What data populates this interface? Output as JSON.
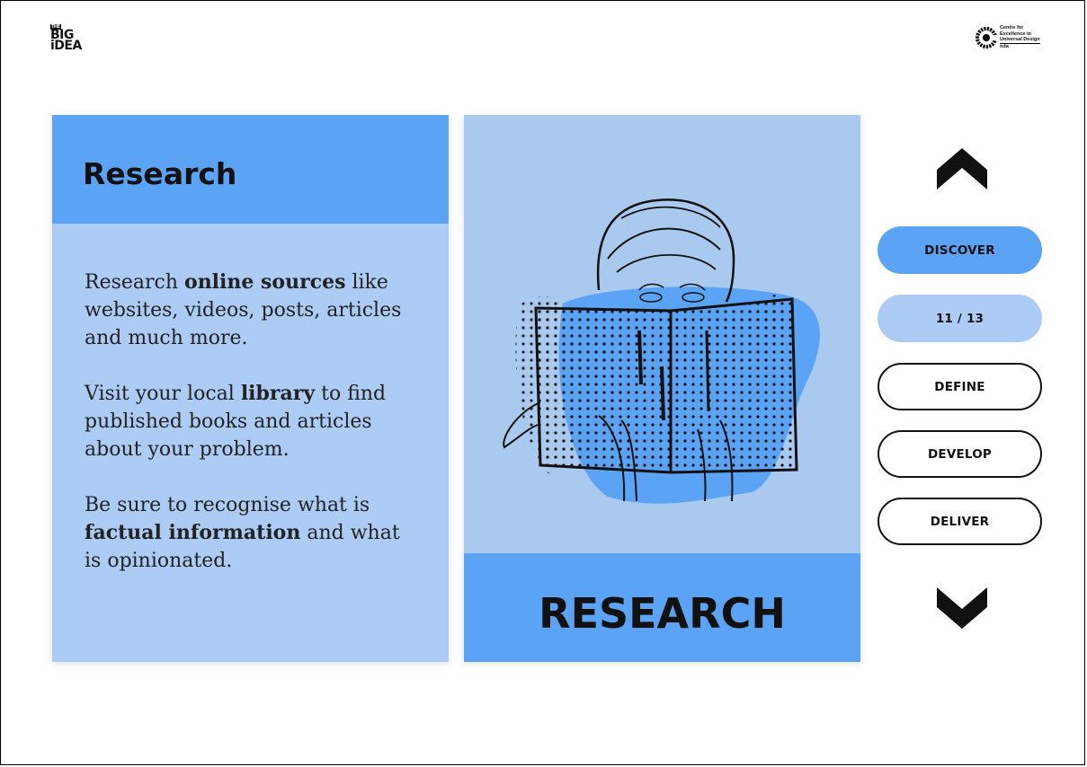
{
  "logo": {
    "the": "THE",
    "big": "BIG",
    "idea": "iDEA"
  },
  "partner": {
    "line1": "Centre for",
    "line2": "Excellence in",
    "line3": "Universal Design",
    "org": "nda"
  },
  "content": {
    "title": "Research",
    "p1": {
      "t1": "Research ",
      "b1": "online sources",
      "t2": " like websites, videos, posts, articles and much more."
    },
    "p2": {
      "t1": "Visit your local ",
      "b1": "library",
      "t2": " to find published books and articles about your problem."
    },
    "p3": {
      "t1": "Be sure to recognise what is ",
      "b1": "factual information",
      "t2": " and what is opinionated."
    }
  },
  "illustration": {
    "caption": "RESEARCH"
  },
  "nav": {
    "discover": "DISCOVER",
    "page": "11 / 13",
    "define": "DEFINE",
    "develop": "DEVELOP",
    "deliver": "DELIVER"
  },
  "colors": {
    "accent": "#5ba3f4",
    "accent_light": "#acccf5",
    "text": "#111111"
  }
}
